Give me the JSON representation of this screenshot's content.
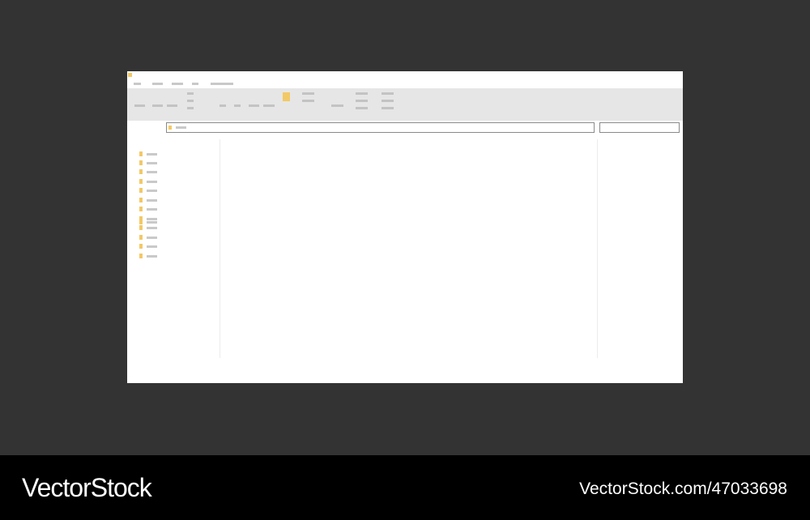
{
  "watermark": {
    "brand": "VectorStock",
    "url": "VectorStock.com/47033698"
  },
  "colors": {
    "background": "#333333",
    "window": "#ffffff",
    "ribbon": "#e6e6e6",
    "folder": "#f3c966",
    "placeholder_text": "#c9c9c9",
    "banner": "#000000"
  },
  "icons": {
    "app": "folder-icon",
    "ribbon": "folder-icon",
    "address": "folder-icon",
    "tree": "folder-icon"
  },
  "window": {
    "menu_item_count": 5,
    "tree_item_count": 12
  }
}
